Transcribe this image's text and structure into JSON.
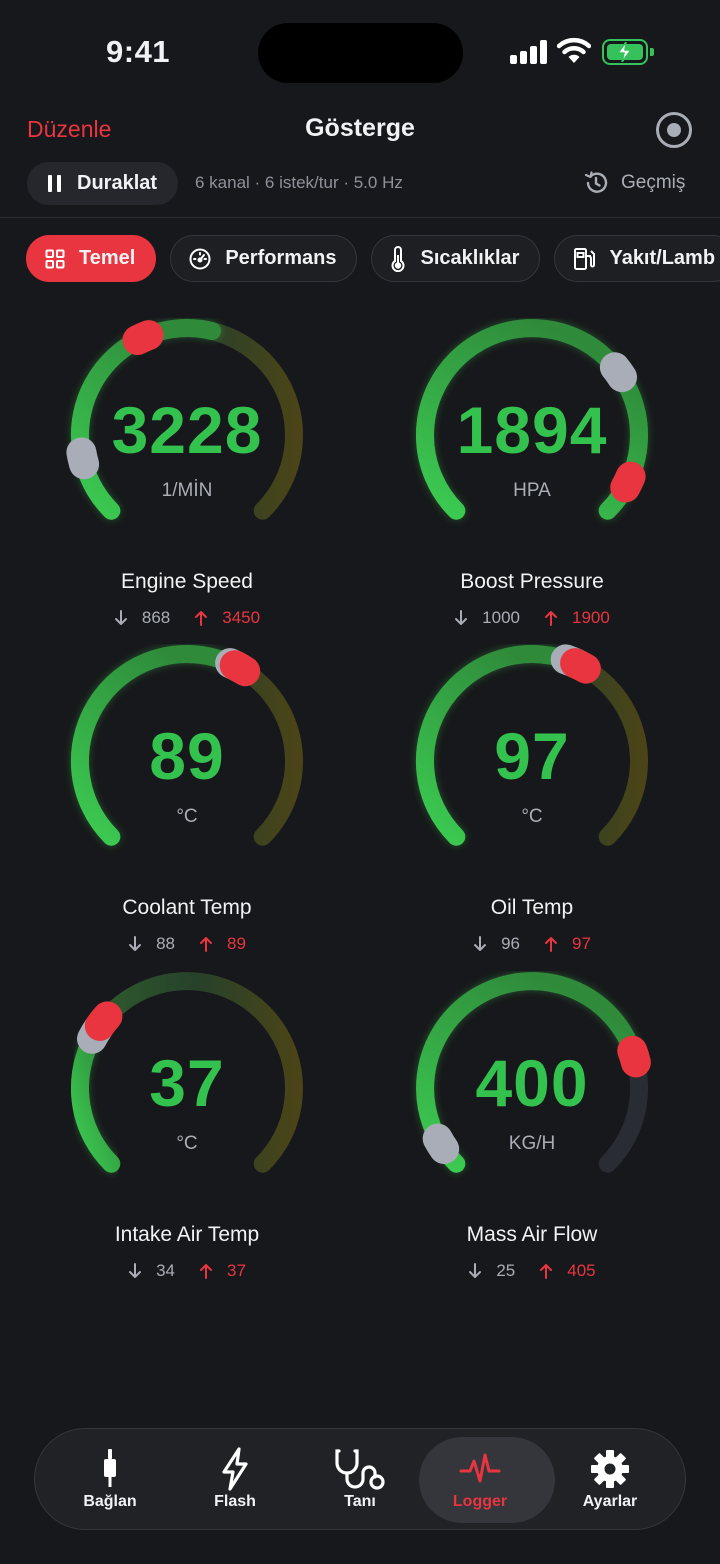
{
  "status_bar": {
    "time": "9:41"
  },
  "header": {
    "edit_label": "Düzenle",
    "title": "Gösterge",
    "record_icon": "record-icon"
  },
  "toolbar": {
    "pause_label": "Duraklat",
    "info": "6 kanal · 6 istek/tur · 5.0 Hz",
    "history_label": "Geçmiş"
  },
  "chips": [
    {
      "label": "Temel",
      "icon": "grid-icon",
      "active": true
    },
    {
      "label": "Performans",
      "icon": "speedometer-icon",
      "active": false
    },
    {
      "label": "Sıcaklıklar",
      "icon": "thermometer-icon",
      "active": false
    },
    {
      "label": "Yakıt/Lamb",
      "icon": "fuel-pump-icon",
      "active": false
    }
  ],
  "colors": {
    "accent": "#e8353f",
    "value": "#34c24e",
    "muted": "#a9adb5",
    "background": "#17181b"
  },
  "gauges": [
    {
      "name": "Engine Speed",
      "value": "3228",
      "unit": "1/MİN",
      "min": "868",
      "max": "3450",
      "level": 0.55,
      "min_marker": 0.12,
      "max_marker": 0.41
    },
    {
      "name": "Boost Pressure",
      "value": "1894",
      "unit": "HPA",
      "min": "1000",
      "max": "1900",
      "level": 1.0,
      "min_marker": 0.7,
      "max_marker": 0.93
    },
    {
      "name": "Coolant Temp",
      "value": "89",
      "unit": "°C",
      "min": "88",
      "max": "89",
      "level": 0.6,
      "min_marker": 0.6,
      "max_marker": 0.61
    },
    {
      "name": "Oil Temp",
      "value": "97",
      "unit": "°C",
      "min": "96",
      "max": "97",
      "level": 0.59,
      "min_marker": 0.58,
      "max_marker": 0.6
    },
    {
      "name": "Intake Air Temp",
      "value": "37",
      "unit": "°C",
      "min": "34",
      "max": "37",
      "level": 0.3,
      "min_marker": 0.28,
      "max_marker": 0.31
    },
    {
      "name": "Mass Air Flow",
      "value": "400",
      "unit": "KG/H",
      "min": "25",
      "max": "405",
      "level": 0.77,
      "min_marker": 0.05,
      "max_marker": 0.77
    }
  ],
  "tabs": [
    {
      "label": "Bağlan",
      "icon": "connector-icon",
      "active": false
    },
    {
      "label": "Flash",
      "icon": "lightning-icon",
      "active": false
    },
    {
      "label": "Tanı",
      "icon": "stethoscope-icon",
      "active": false
    },
    {
      "label": "Logger",
      "icon": "waveform-icon",
      "active": true
    },
    {
      "label": "Ayarlar",
      "icon": "gear-icon",
      "active": false
    }
  ]
}
